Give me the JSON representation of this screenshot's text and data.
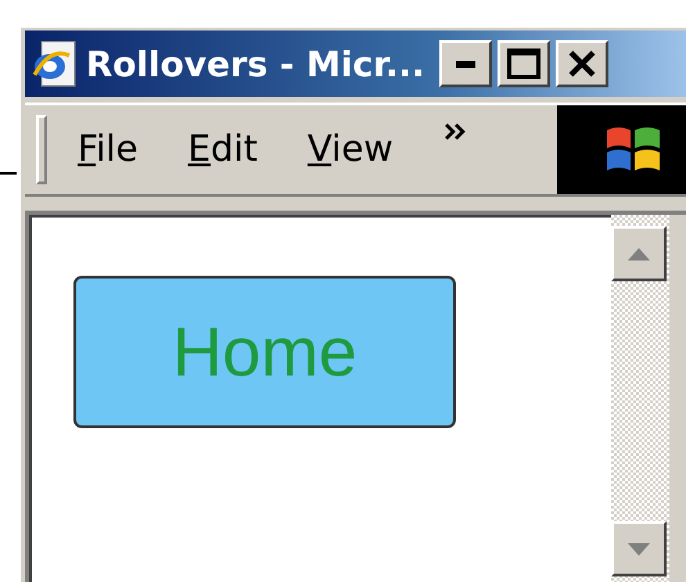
{
  "window": {
    "title": "Rollovers - Micr..."
  },
  "menu": [
    {
      "label": "File"
    },
    {
      "label": "Edit"
    },
    {
      "label": "View"
    }
  ],
  "page": {
    "rollover_button": {
      "label": "Home"
    }
  }
}
